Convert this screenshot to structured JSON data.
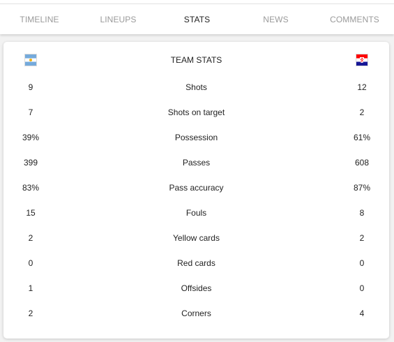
{
  "tabs": [
    {
      "label": "TIMELINE",
      "active": false
    },
    {
      "label": "LINEUPS",
      "active": false
    },
    {
      "label": "STATS",
      "active": true
    },
    {
      "label": "NEWS",
      "active": false
    },
    {
      "label": "COMMENTS",
      "active": false
    }
  ],
  "stats": {
    "title": "TEAM STATS",
    "home_flag_icon": "argentina-flag-icon",
    "away_flag_icon": "croatia-flag-icon",
    "rows": [
      {
        "label": "Shots",
        "home": "9",
        "away": "12"
      },
      {
        "label": "Shots on target",
        "home": "7",
        "away": "2"
      },
      {
        "label": "Possession",
        "home": "39%",
        "away": "61%"
      },
      {
        "label": "Passes",
        "home": "399",
        "away": "608"
      },
      {
        "label": "Pass accuracy",
        "home": "83%",
        "away": "87%"
      },
      {
        "label": "Fouls",
        "home": "15",
        "away": "8"
      },
      {
        "label": "Yellow cards",
        "home": "2",
        "away": "2"
      },
      {
        "label": "Red cards",
        "home": "0",
        "away": "0"
      },
      {
        "label": "Offsides",
        "home": "1",
        "away": "0"
      },
      {
        "label": "Corners",
        "home": "2",
        "away": "4"
      }
    ]
  },
  "colors": {
    "active_tab": "#222222",
    "inactive_tab": "#9a9a9a",
    "page_background": "#f2f2f2"
  }
}
